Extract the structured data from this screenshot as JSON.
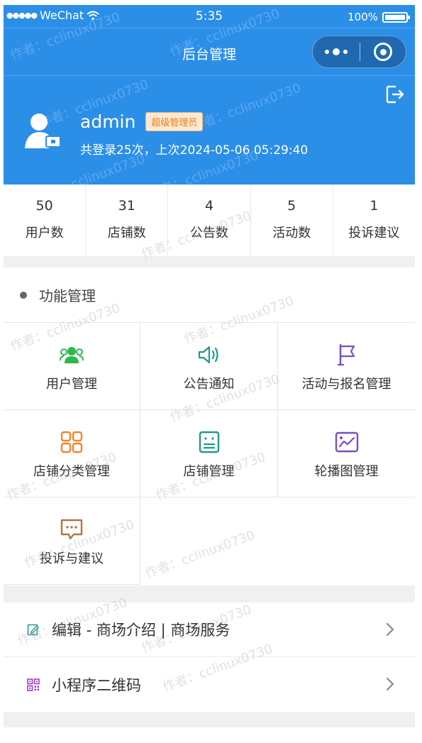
{
  "status_bar": {
    "carrier": "WeChat",
    "time": "5:35",
    "battery": "100%"
  },
  "navbar": {
    "title": "后台管理"
  },
  "profile": {
    "username": "admin",
    "role": "超级管理员",
    "login_info": "共登录25次，上次2024-05-06 05:29:40"
  },
  "stats": [
    {
      "value": "50",
      "label": "用户数"
    },
    {
      "value": "31",
      "label": "店铺数"
    },
    {
      "value": "4",
      "label": "公告数"
    },
    {
      "value": "5",
      "label": "活动数"
    },
    {
      "value": "1",
      "label": "投诉建议"
    }
  ],
  "functions": {
    "title": "功能管理",
    "items": [
      {
        "label": "用户管理",
        "icon": "users-icon",
        "color": "#2db84d"
      },
      {
        "label": "公告通知",
        "icon": "speaker-icon",
        "color": "#1e9a8a"
      },
      {
        "label": "活动与报名管理",
        "icon": "flag-icon",
        "color": "#7a4cc4"
      },
      {
        "label": "店铺分类管理",
        "icon": "grid-icon",
        "color": "#f0862a"
      },
      {
        "label": "店铺管理",
        "icon": "list-box-icon",
        "color": "#1e9a8a"
      },
      {
        "label": "轮播图管理",
        "icon": "image-chart-icon",
        "color": "#7a4cc4"
      },
      {
        "label": "投诉与建议",
        "icon": "chat-icon",
        "color": "#b07646"
      }
    ]
  },
  "links": [
    {
      "label": "编辑 - 商场介绍 | 商场服务",
      "icon": "edit-icon",
      "color": "#1e9a8a"
    },
    {
      "label": "小程序二维码",
      "icon": "qrcode-icon",
      "color": "#9b3fc2"
    }
  ],
  "watermark": "作者：cclinux0730",
  "colors": {
    "primary": "#2b8fe8",
    "badge_bg": "#fde9d2",
    "badge_text": "#f07a18"
  }
}
